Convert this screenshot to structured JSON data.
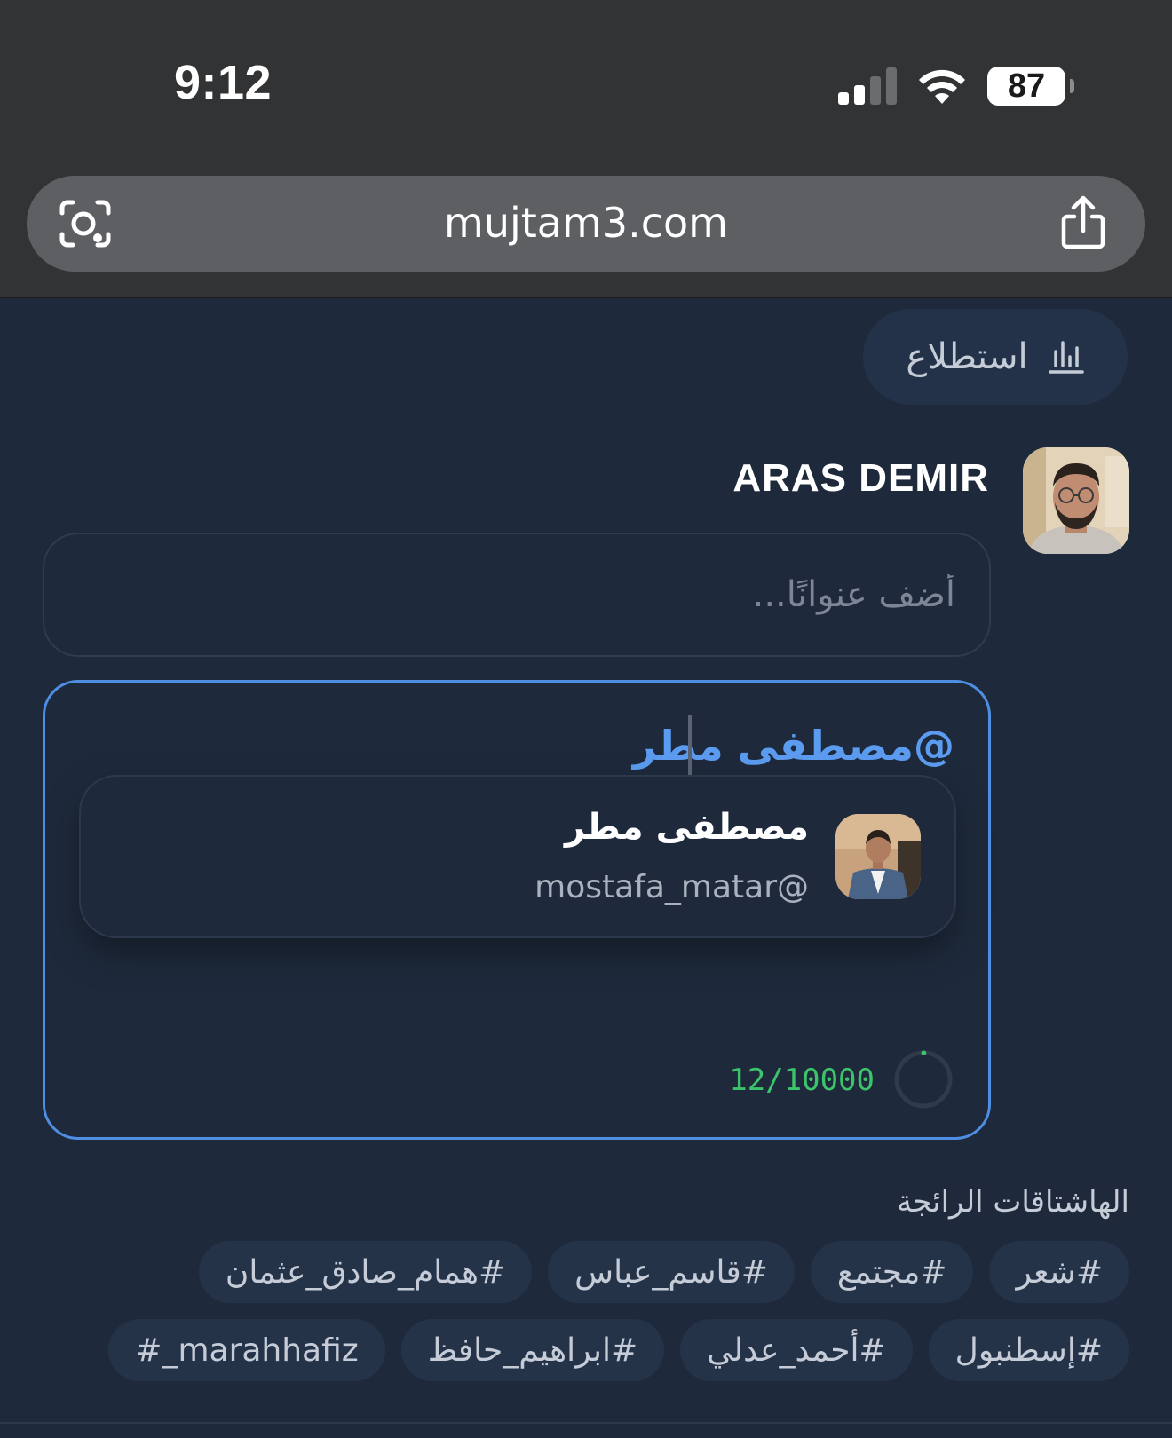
{
  "status_bar": {
    "time": "9:12",
    "battery": "87",
    "icons": [
      "cellular-signal-icon",
      "wifi-icon",
      "battery-icon"
    ]
  },
  "browser": {
    "url": "mujtam3.com",
    "icons": [
      "visual-search-icon",
      "share-icon"
    ]
  },
  "composer": {
    "poll_label": "استطلاع",
    "poll_icon": "bar-chart-icon",
    "author_name": "ARAS DEMIR",
    "title_placeholder": "أضف عنوانًا...",
    "body_text": "@مصطفى مطر",
    "mention_suggestion": {
      "name": "مصطفى مطر",
      "handle": "mostafa_matar@"
    },
    "char_counter": "12/10000",
    "counter_progress": 0.0012
  },
  "trending": {
    "title": "الهاشتاقات الرائجة",
    "rows": [
      [
        "#شعر",
        "#مجتمع",
        "#قاسم_عباس",
        "#همام_صادق_عثمان"
      ],
      [
        "#إسطنبول",
        "#أحمد_عدلي",
        "#ابراهيم_حافظ",
        "marahhafiz_#"
      ]
    ]
  },
  "colors": {
    "background": "#1e2a3c",
    "accent": "#4e8fe3",
    "mention": "#5c9cf0",
    "counter": "#3cc46b",
    "chrome": "#323335"
  }
}
